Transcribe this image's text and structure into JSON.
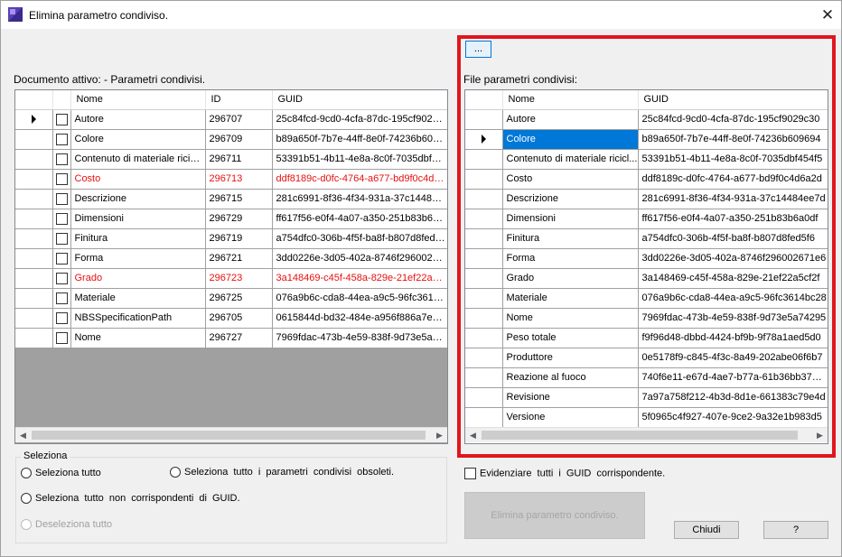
{
  "window": {
    "title": "Elimina parametro condiviso.",
    "close_glyph": "✕"
  },
  "left_panel": {
    "label": "Documento attivo: - Parametri condivisi.",
    "columns": [
      "Nome",
      "ID",
      "GUID"
    ],
    "rows": [
      {
        "name": "Autore",
        "id": "296707",
        "guid": "25c84fcd-9cd0-4cfa-87dc-195cf9029c...",
        "red": false,
        "current": true
      },
      {
        "name": "Colore",
        "id": "296709",
        "guid": "b89a650f-7b7e-44ff-8e0f-74236b609694",
        "red": false,
        "current": false
      },
      {
        "name": "Contenuto di materiale ricicl...",
        "id": "296711",
        "guid": "53391b51-4b11-4e8a-8c0f-7035dbf45...",
        "red": false,
        "current": false
      },
      {
        "name": "Costo",
        "id": "296713",
        "guid": "ddf8189c-d0fc-4764-a677-bd9f0c4d6a...",
        "red": true,
        "current": false
      },
      {
        "name": "Descrizione",
        "id": "296715",
        "guid": "281c6991-8f36-4f34-931a-37c14484e...",
        "red": false,
        "current": false
      },
      {
        "name": "Dimensioni",
        "id": "296729",
        "guid": "ff617f56-e0f4-4a07-a350-251b83b6a0df",
        "red": false,
        "current": false
      },
      {
        "name": "Finitura",
        "id": "296719",
        "guid": "a754dfc0-306b-4f5f-ba8f-b807d8fed5f6",
        "red": false,
        "current": false
      },
      {
        "name": "Forma",
        "id": "296721",
        "guid": "3dd0226e-3d05-402a-8746f29600267...",
        "red": false,
        "current": false
      },
      {
        "name": "Grado",
        "id": "296723",
        "guid": "3a148469-c45f-458a-829e-21ef22a5cf2f",
        "red": true,
        "current": false
      },
      {
        "name": "Materiale",
        "id": "296725",
        "guid": "076a9b6c-cda8-44ea-a9c5-96fc3614b...",
        "red": false,
        "current": false
      },
      {
        "name": "NBSSpecificationPath",
        "id": "296705",
        "guid": "0615844d-bd32-484e-a956f886a7e3f...",
        "red": false,
        "current": false
      },
      {
        "name": "Nome",
        "id": "296727",
        "guid": "7969fdac-473b-4e59-838f-9d73e5a74...",
        "red": false,
        "current": false
      }
    ]
  },
  "right_panel": {
    "browse_label": "...",
    "label": "File parametri condivisi:",
    "columns": [
      "Nome",
      "GUID"
    ],
    "rows": [
      {
        "name": "Autore",
        "guid": "25c84fcd-9cd0-4cfa-87dc-195cf9029c30",
        "selected": false
      },
      {
        "name": "Colore",
        "guid": "b89a650f-7b7e-44ff-8e0f-74236b609694",
        "selected": true
      },
      {
        "name": "Contenuto di materiale ricicl...",
        "guid": "53391b51-4b11-4e8a-8c0f-7035dbf454f5",
        "selected": false
      },
      {
        "name": "Costo",
        "guid": "ddf8189c-d0fc-4764-a677-bd9f0c4d6a2d",
        "selected": false
      },
      {
        "name": "Descrizione",
        "guid": "281c6991-8f36-4f34-931a-37c14484ee7d",
        "selected": false
      },
      {
        "name": "Dimensioni",
        "guid": "ff617f56-e0f4-4a07-a350-251b83b6a0df",
        "selected": false
      },
      {
        "name": "Finitura",
        "guid": "a754dfc0-306b-4f5f-ba8f-b807d8fed5f6",
        "selected": false
      },
      {
        "name": "Forma",
        "guid": "3dd0226e-3d05-402a-8746f296002671e6",
        "selected": false
      },
      {
        "name": "Grado",
        "guid": "3a148469-c45f-458a-829e-21ef22a5cf2f",
        "selected": false
      },
      {
        "name": "Materiale",
        "guid": "076a9b6c-cda8-44ea-a9c5-96fc3614bc28",
        "selected": false
      },
      {
        "name": "Nome",
        "guid": "7969fdac-473b-4e59-838f-9d73e5a74295",
        "selected": false
      },
      {
        "name": "Peso totale",
        "guid": "f9f96d48-dbbd-4424-bf9b-9f78a1aed5d0",
        "selected": false
      },
      {
        "name": "Produttore",
        "guid": "0e5178f9-c845-4f3c-8a49-202abe06f6b7",
        "selected": false
      },
      {
        "name": "Reazione al fuoco",
        "guid": "740f6e11-e67d-4ae7-b77a-61b36bb37bde",
        "selected": false
      },
      {
        "name": "Revisione",
        "guid": "7a97a758f212-4b3d-8d1e-661383c79e4d",
        "selected": false
      },
      {
        "name": "Versione",
        "guid": "5f0965c4f927-407e-9ce2-9a32e1b983d5",
        "selected": false
      }
    ]
  },
  "selection_group": {
    "title": "Seleziona",
    "select_all": "Seleziona tutto",
    "select_obsolete": "Seleziona tutto i parametri condivisi obsoleti.",
    "select_mismatch": "Seleziona tutto non corrispondenti di GUID.",
    "deselect_all": "Deseleziona tutto"
  },
  "highlight_checkbox": "Evidenziare tutti i GUID corrispondente.",
  "buttons": {
    "delete": "Elimina parametro condiviso.",
    "close": "Chiudi",
    "help": "?"
  },
  "colors": {
    "mismatch_text": "#e81010",
    "selection": "#0078d7",
    "highlight_frame": "#e0161e"
  }
}
